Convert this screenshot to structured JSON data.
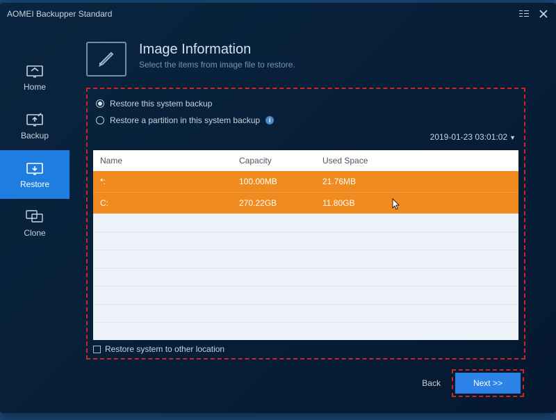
{
  "titlebar": {
    "title": "AOMEI Backupper Standard"
  },
  "sidebar": {
    "items": [
      {
        "label": "Home"
      },
      {
        "label": "Backup"
      },
      {
        "label": "Restore"
      },
      {
        "label": "Clone"
      }
    ]
  },
  "header": {
    "title": "Image Information",
    "subtitle": "Select the items from image file to restore."
  },
  "options": {
    "opt1": "Restore this system backup",
    "opt2": "Restore a partition in this system backup"
  },
  "timestamp": "2019-01-23 03:01:02",
  "table": {
    "cols": {
      "name": "Name",
      "capacity": "Capacity",
      "used": "Used Space"
    },
    "rows": [
      {
        "name": "*:",
        "capacity": "100.00MB",
        "used": "21.76MB"
      },
      {
        "name": "C:",
        "capacity": "270.22GB",
        "used": "11.80GB"
      }
    ]
  },
  "checkbox_label": "Restore system to other location",
  "footer": {
    "back": "Back",
    "next": "Next >>"
  }
}
